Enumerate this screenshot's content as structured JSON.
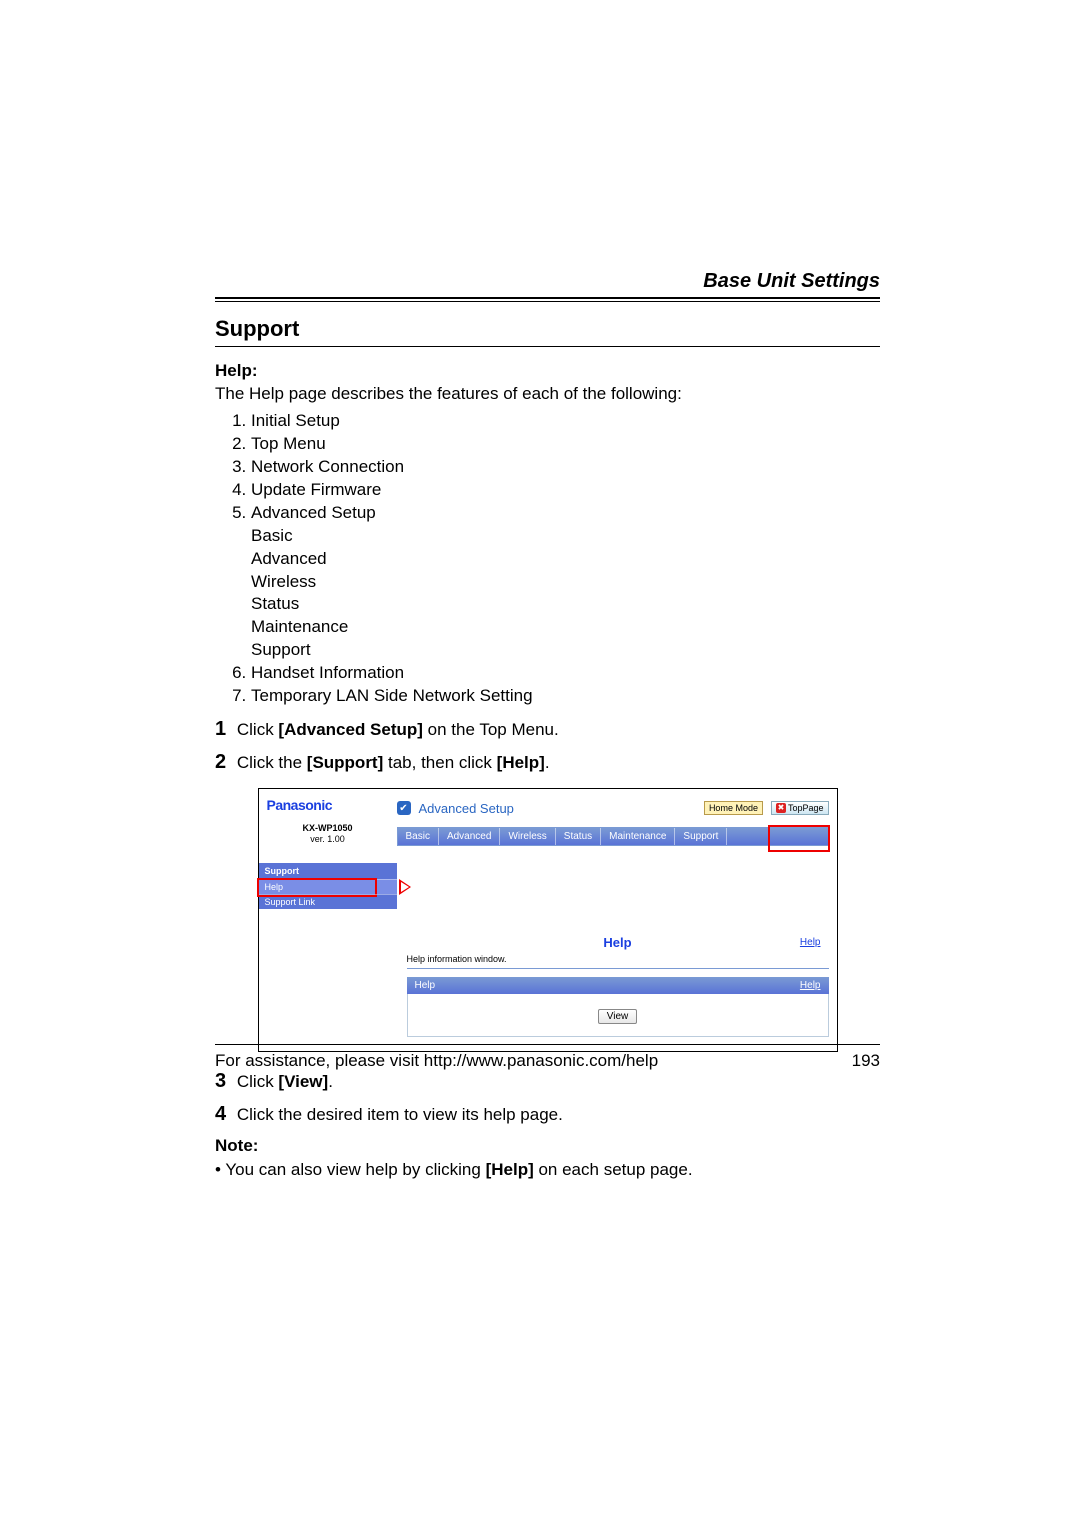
{
  "page": {
    "header": "Base Unit Settings",
    "section_title": "Support",
    "help_label": "Help:",
    "help_intro": "The Help page describes the features of each of the following:",
    "help_items": [
      "Initial Setup",
      "Top Menu",
      "Network Connection",
      "Update Firmware",
      "Advanced Setup",
      "Handset Information",
      "Temporary LAN Side Network Setting"
    ],
    "advanced_sub": [
      "Basic",
      "Advanced",
      "Wireless",
      "Status",
      "Maintenance",
      "Support"
    ],
    "step1_pre": "Click ",
    "step1_bold": "[Advanced Setup]",
    "step1_post": " on the Top Menu.",
    "step2_pre": "Click the ",
    "step2_bold1": "[Support]",
    "step2_mid": " tab, then click ",
    "step2_bold2": "[Help]",
    "step2_post": ".",
    "step3_pre": "Click ",
    "step3_bold": "[View]",
    "step3_post": ".",
    "step4": "Click the desired item to view its help page.",
    "note_label": "Note:",
    "note_pre": "You can also view help by clicking ",
    "note_bold": "[Help]",
    "note_post": " on each setup page.",
    "footer_text": "For assistance, please visit http://www.panasonic.com/help",
    "footer_page": "193"
  },
  "shot": {
    "brand": "Panasonic",
    "model_line1": "KX-WP1050",
    "model_line2": "ver. 1.00",
    "side_title": "Support",
    "side_items": [
      "Help",
      "Support Link"
    ],
    "main_title": "Advanced Setup",
    "mode_btn": "Home Mode",
    "top_btn": "TopPage",
    "tabs": [
      "Basic",
      "Advanced",
      "Wireless",
      "Status",
      "Maintenance",
      "Support"
    ],
    "help_heading": "Help",
    "corner_help": "Help",
    "help_desc": "Help information window.",
    "bar_left": "Help",
    "bar_right": "Help",
    "view_btn": "View"
  }
}
